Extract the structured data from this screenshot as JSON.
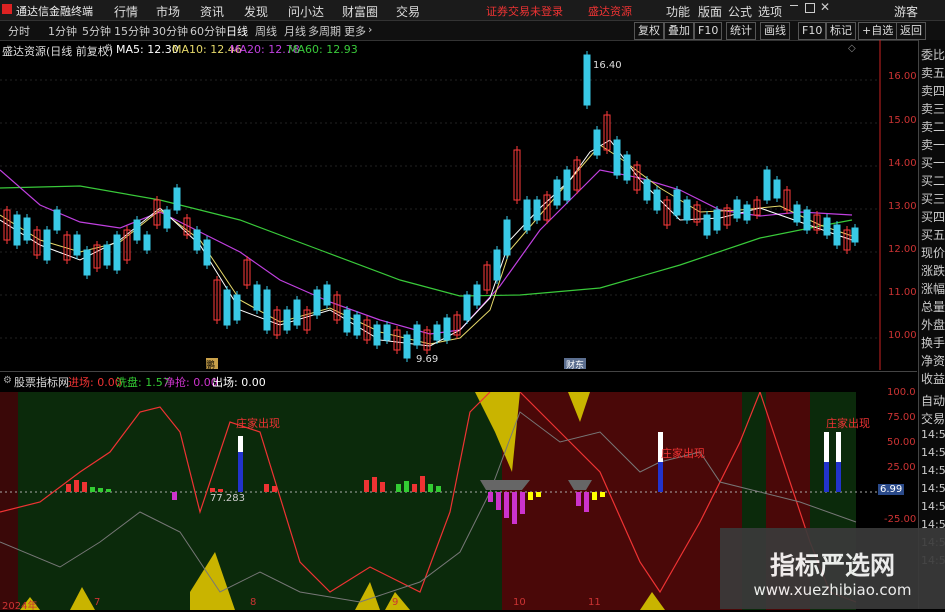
{
  "app": {
    "title": "通达信金融终端"
  },
  "menu": [
    "行情",
    "市场",
    "资讯",
    "发现",
    "问小达",
    "财富圈",
    "交易"
  ],
  "top_notice": [
    "证券交易未登录",
    "盛达资源"
  ],
  "top_right_menu": [
    "功能",
    "版面",
    "公式",
    "选项",
    "游客"
  ],
  "toolbar": {
    "periods": [
      "分时",
      "1分钟",
      "5分钟",
      "15分钟",
      "30分钟",
      "60分钟",
      "日线",
      "周线",
      "月线",
      "多周期",
      "更多"
    ],
    "right_buttons": [
      "复权",
      "叠加",
      "F10",
      "统计",
      "画线",
      "F10",
      "标记",
      "+自选",
      "返回"
    ]
  },
  "main_chart": {
    "title": "盛达资源(日线 前复权)",
    "ma": [
      {
        "label": "MA5: 12.30",
        "color": "#ffffff"
      },
      {
        "label": "MA10: 12.46",
        "color": "#e6d96a"
      },
      {
        "label": "MA20: 12.78",
        "color": "#c040e0"
      },
      {
        "label": "MA60: 12.93",
        "color": "#39c93a"
      }
    ],
    "price_ticks": [
      "16.00",
      "15.00",
      "14.00",
      "13.00",
      "12.00",
      "11.00",
      "10.00"
    ],
    "high_label": "16.40",
    "low_label": "9.69",
    "markers": [
      "鹏",
      "财东"
    ]
  },
  "indicator": {
    "title": "股票指标网",
    "items": [
      {
        "label": "进场: 0.00",
        "color": "#e33"
      },
      {
        "label": "洗盘: 1.57",
        "color": "#3c3"
      },
      {
        "label": "净抢: 0.00",
        "color": "#c3c"
      },
      {
        "label": "出场: 0.00",
        "color": "#fff"
      }
    ],
    "ticks": [
      "100.0",
      "75.00",
      "50.00",
      "25.00",
      "-25.00"
    ],
    "current_value": "6.99",
    "annotations": [
      "庄家出现",
      "庄家出现",
      "庄家出现"
    ],
    "value_label": "77.283"
  },
  "x_axis": [
    "2024年",
    "7",
    "8",
    "9",
    "10",
    "11"
  ],
  "right_panel": {
    "quote_labels": [
      "委比",
      "卖五",
      "卖四",
      "卖三",
      "卖二",
      "卖一",
      "买一",
      "买二",
      "买三",
      "买四",
      "买五",
      "现价",
      "涨跌",
      "涨幅",
      "总量",
      "外盘",
      "换手",
      "净资",
      "收益",
      "自动",
      "交易"
    ],
    "time_labels": [
      "14:5",
      "14:5",
      "14:5",
      "14:5",
      "14:5",
      "14:5",
      "14:5",
      "14:5"
    ]
  },
  "watermark": {
    "title": "指标严选网",
    "url": "www.xuezhibiao.com"
  }
}
